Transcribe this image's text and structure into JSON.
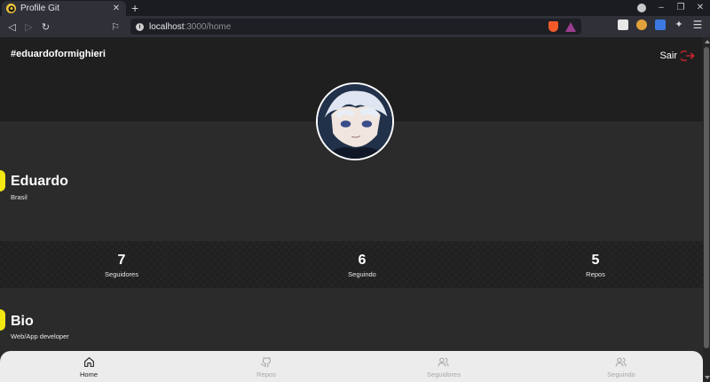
{
  "browser": {
    "tab_title": "Profile Git",
    "tab_close": "✕",
    "new_tab": "+",
    "url_host": "localhost",
    "url_path": ":3000/home",
    "win_minimize": "–",
    "win_maximize": "❐",
    "win_close": "✕"
  },
  "header": {
    "username": "#eduardoformighieri",
    "logout_label": "Sair",
    "logout_color": "#e0252e"
  },
  "profile": {
    "name": "Eduardo",
    "location": "Brasil",
    "accent_color": "#f3e812"
  },
  "stats": [
    {
      "value": "7",
      "label": "Seguidores"
    },
    {
      "value": "6",
      "label": "Seguindo"
    },
    {
      "value": "5",
      "label": "Repos"
    }
  ],
  "bio": {
    "title": "Bio",
    "text": "Web/App developer"
  },
  "bottom_nav": [
    {
      "label": "Home",
      "icon": "home-icon",
      "active": true
    },
    {
      "label": "Repos",
      "icon": "github-icon",
      "active": false
    },
    {
      "label": "Seguidores",
      "icon": "users-icon",
      "active": false
    },
    {
      "label": "Seguindo",
      "icon": "users-icon",
      "active": false
    }
  ]
}
